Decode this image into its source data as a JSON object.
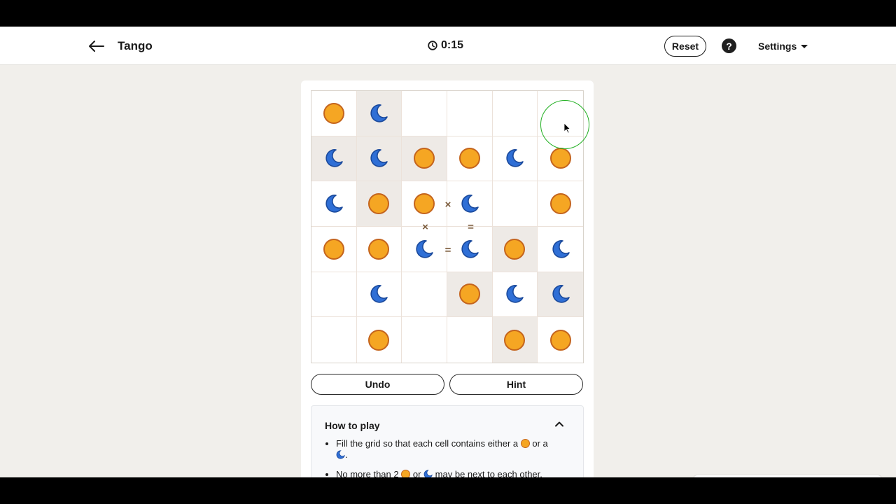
{
  "header": {
    "title": "Tango",
    "timer": "0:15",
    "reset_label": "Reset",
    "help_label": "?",
    "settings_label": "Settings"
  },
  "board": {
    "size": 6,
    "rows": [
      [
        "sun",
        "moon",
        "",
        "",
        "",
        ""
      ],
      [
        "moon",
        "moon",
        "sun",
        "sun",
        "moon",
        "sun"
      ],
      [
        "moon",
        "sun",
        "sun",
        "moon",
        "",
        "sun"
      ],
      [
        "sun",
        "sun",
        "moon",
        "moon",
        "sun",
        "moon"
      ],
      [
        "",
        "moon",
        "",
        "sun",
        "moon",
        "moon"
      ],
      [
        "",
        "sun",
        "",
        "",
        "sun",
        "sun"
      ]
    ],
    "locked": [
      [
        1,
        0
      ],
      [
        0,
        1
      ],
      [
        1,
        1
      ],
      [
        2,
        1
      ],
      [
        1,
        2
      ],
      [
        4,
        3
      ],
      [
        3,
        4
      ],
      [
        5,
        4
      ],
      [
        4,
        5
      ]
    ],
    "constraints": [
      {
        "between": [
          [
            2,
            2
          ],
          [
            2,
            3
          ]
        ],
        "symbol": "×"
      },
      {
        "between": [
          [
            2,
            2
          ],
          [
            3,
            2
          ]
        ],
        "symbol": "×"
      },
      {
        "between": [
          [
            2,
            3
          ],
          [
            3,
            3
          ]
        ],
        "symbol": "="
      },
      {
        "between": [
          [
            3,
            2
          ],
          [
            3,
            3
          ]
        ],
        "symbol": "="
      }
    ]
  },
  "controls": {
    "undo_label": "Undo",
    "hint_label": "Hint"
  },
  "how_to_play": {
    "title": "How to play",
    "rule1_a": "Fill the grid so that each cell contains either a",
    "rule1_b": "or a",
    "rule1_c": ".",
    "rule2_a": "No more than 2",
    "rule2_b": "or",
    "rule2_c": "may be next to each other,"
  },
  "colors": {
    "sun_fill": "#f5a623",
    "sun_stroke": "#c4641d",
    "moon_fill": "#2f6fd6",
    "locked_cell": "#eeeae6",
    "cursor_ring": "#22b022"
  },
  "icons": {
    "back": "arrow-left-icon",
    "timer": "clock-icon",
    "help": "question-icon",
    "settings": "caret-down-icon",
    "collapse": "chevron-up-icon"
  }
}
